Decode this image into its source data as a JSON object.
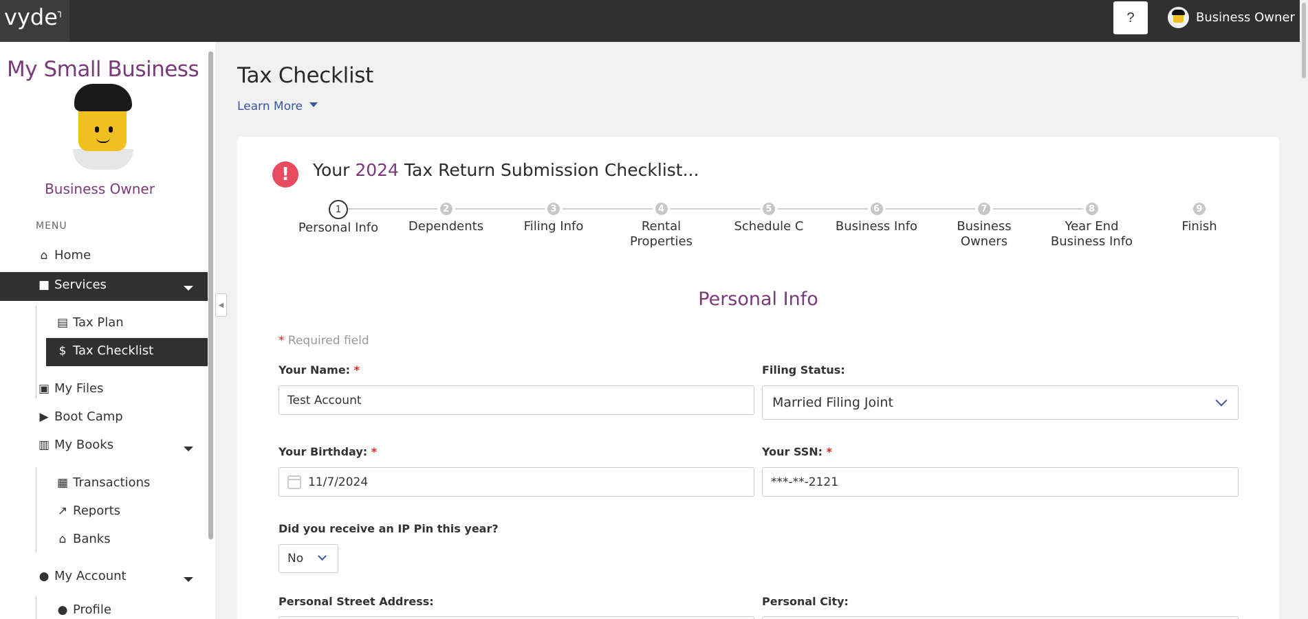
{
  "app": {
    "logo": "vyde",
    "help_label": "?",
    "user_name": "Business Owner"
  },
  "sidebar": {
    "business_name": "My Small Business",
    "owner_name": "Business Owner",
    "menu_label": "MENU",
    "items": {
      "home": "Home",
      "services": "Services",
      "tax_plan": "Tax Plan",
      "tax_checklist": "Tax Checklist",
      "my_files": "My Files",
      "boot_camp": "Boot Camp",
      "my_books": "My Books",
      "transactions": "Transactions",
      "reports": "Reports",
      "banks": "Banks",
      "my_account": "My Account",
      "profile": "Profile"
    }
  },
  "page": {
    "title": "Tax Checklist",
    "learn_more": "Learn More"
  },
  "card": {
    "alert_symbol": "!",
    "heading_pre": "Your",
    "heading_year": "2024",
    "heading_post": "Tax Return Submission Checklist..."
  },
  "steps": [
    {
      "num": "1",
      "label": "Personal Info",
      "current": true
    },
    {
      "num": "2",
      "label": "Dependents"
    },
    {
      "num": "3",
      "label": "Filing Info"
    },
    {
      "num": "4",
      "label": "Rental Properties"
    },
    {
      "num": "5",
      "label": "Schedule C"
    },
    {
      "num": "6",
      "label": "Business Info"
    },
    {
      "num": "7",
      "label": "Business Owners"
    },
    {
      "num": "8",
      "label": "Year End Business Info"
    },
    {
      "num": "9",
      "label": "Finish"
    }
  ],
  "form": {
    "section_title": "Personal Info",
    "required_note": "Required field",
    "name_label": "Your Name:",
    "name_value": "Test Account",
    "filing_status_label": "Filing Status:",
    "filing_status_value": "Married Filing Joint",
    "birthday_label": "Your Birthday:",
    "birthday_value": "11/7/2024",
    "ssn_label": "Your SSN:",
    "ssn_value": "***-**-2121",
    "ip_pin_label": "Did you receive an IP Pin this year?",
    "ip_pin_value": "No",
    "street_label": "Personal Street Address:",
    "city_label": "Personal City:"
  }
}
